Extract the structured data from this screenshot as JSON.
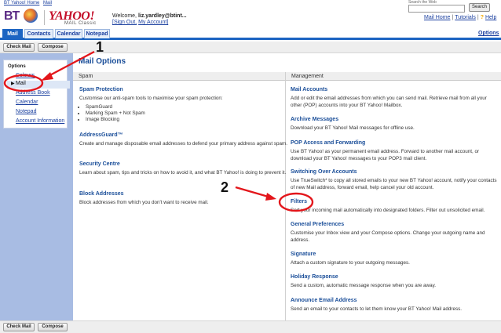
{
  "util": {
    "bt_yahoo_home": "BT Yahoo! Home",
    "mail": "Mail",
    "search_hint": "Search the Web",
    "search_button": "Search"
  },
  "header": {
    "bt": "BT",
    "yahoo": "YAHOO!",
    "mail_classic": "MAIL Classic",
    "welcome": "Welcome,",
    "user": "liz.yardley@btint...",
    "sign_out": "[Sign Out,",
    "my_account": "My Account]",
    "mail_home": "Mail Home",
    "tutorials": "Tutorials",
    "help": "Help"
  },
  "tabs": [
    "Mail",
    "Contacts",
    "Calendar",
    "Notepad"
  ],
  "options_link": "Options",
  "actions": {
    "check_mail": "Check Mail",
    "compose": "Compose"
  },
  "sidebar": {
    "title": "Options",
    "items": [
      "Colours",
      "Mail",
      "Address Book",
      "Calendar",
      "Notepad",
      "Account Information"
    ]
  },
  "main": {
    "title": "Mail Options",
    "spam_head": "Spam",
    "management_head": "Management",
    "spam": [
      {
        "title": "Spam Protection",
        "desc": "Customise our anti-spam tools to maximise your spam protection:",
        "bullets": [
          "SpamGuard",
          "Marking Spam + Not Spam",
          "Image Blocking"
        ]
      },
      {
        "title": "AddressGuard™",
        "desc": "Create and manage disposable email addresses to defend your primary address against spam."
      },
      {
        "title": "Security Centre",
        "desc": "Learn about spam, tips and tricks on how to avoid it, and what BT Yahoo! is doing to prevent it."
      },
      {
        "title": "Block Addresses",
        "desc": "Block addresses from which you don't want to receive mail."
      }
    ],
    "management": [
      {
        "title": "Mail Accounts",
        "desc": "Add or edit the email addresses from which you can send mail. Retrieve mail from all your other (POP) accounts into your BT Yahoo! Mailbox."
      },
      {
        "title": "Archive Messages",
        "desc": "Download your BT Yahoo! Mail messages for offline use."
      },
      {
        "title": "POP Access and Forwarding",
        "desc": "Use BT Yahoo! as your permanent email address. Forward to another mail account, or download your BT Yahoo! messages to your POP3 mail client."
      },
      {
        "title": "Switching Over Accounts",
        "desc": "Use TrueSwitch* to copy all stored emails to your new BT Yahoo! account, notify your contacts of new Mail address, forward email, help cancel your old account."
      },
      {
        "title": "Filters",
        "desc": "Sort your incoming mail automatically into designated folders. Filter out unsolicited email."
      },
      {
        "title": "General Preferences",
        "desc": "Customise your Inbox view and your Compose options. Change your outgoing name and address."
      },
      {
        "title": "Signature",
        "desc": "Attach a custom signature to your outgoing messages."
      },
      {
        "title": "Holiday Response",
        "desc": "Send a custom, automatic message response when you are away."
      },
      {
        "title": "Announce Email Address",
        "desc": "Send an email to your contacts to let them know your BT Yahoo! Mail address."
      }
    ]
  },
  "annotations": {
    "one": "1",
    "two": "2",
    "color": "#e3161b"
  }
}
